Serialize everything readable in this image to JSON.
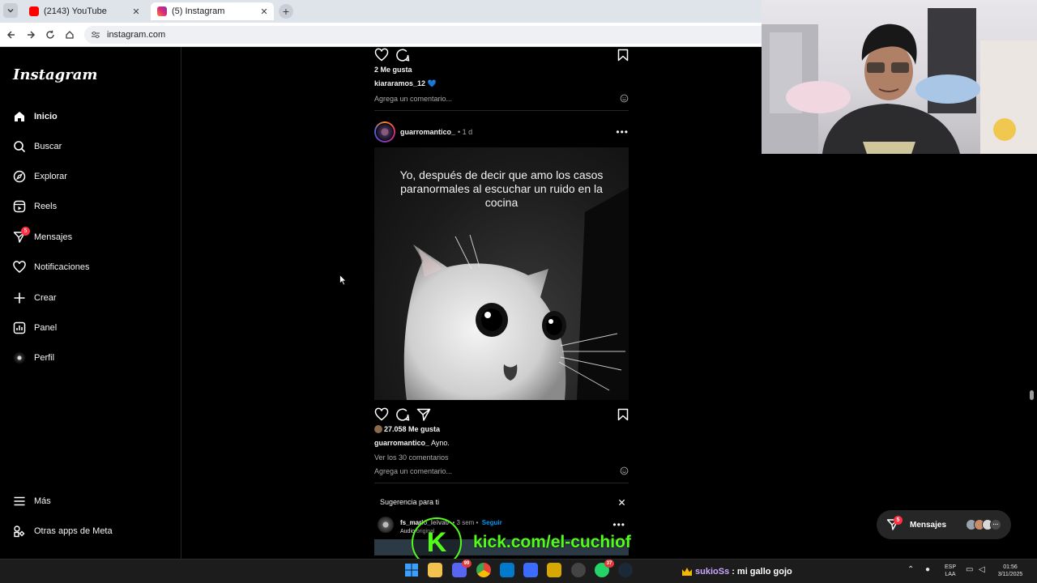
{
  "browser": {
    "tabs": [
      {
        "title": "(2143) YouTube",
        "color": "#ff0000"
      },
      {
        "title": "(5) Instagram",
        "color": "#d6249f"
      }
    ],
    "new_tab": "+",
    "url": "instagram.com"
  },
  "instagram": {
    "logo": "Instagram",
    "nav": [
      {
        "label": "Inicio",
        "icon": "home-icon"
      },
      {
        "label": "Buscar",
        "icon": "search-icon"
      },
      {
        "label": "Explorar",
        "icon": "compass-icon"
      },
      {
        "label": "Reels",
        "icon": "reels-icon"
      },
      {
        "label": "Mensajes",
        "icon": "messenger-icon",
        "badge": "5"
      },
      {
        "label": "Notificaciones",
        "icon": "heart-icon"
      },
      {
        "label": "Crear",
        "icon": "plus-icon"
      },
      {
        "label": "Panel",
        "icon": "dashboard-icon"
      },
      {
        "label": "Perfil",
        "icon": "avatar"
      }
    ],
    "bottom_nav": [
      {
        "label": "Más",
        "icon": "menu-icon"
      },
      {
        "label": "Otras apps de Meta",
        "icon": "meta-apps-icon"
      }
    ],
    "feed": {
      "prev_post": {
        "likes": "2 Me gusta",
        "caption_user": "kiararamos_12",
        "caption_text": "💙",
        "comment_placeholder": "Agrega un comentario..."
      },
      "post": {
        "user": "guarromantico_",
        "time": "• 1 d",
        "meme_text": "Yo, después de decir que amo los casos paranormales al escuchar un ruido en la cocina",
        "likes": "27.058 Me gusta",
        "caption_user": "guarromantico_",
        "caption_text": "Ayno.",
        "view_comments": "Ver los 30 comentarios",
        "comment_placeholder": "Agrega un comentario..."
      },
      "suggestion": {
        "heading": "Sugerencia para ti",
        "user": "fs_mario_leiva0",
        "time": "• 3 sem •",
        "follow": "Seguir",
        "audio": "Audio original"
      }
    },
    "messages_pill": {
      "label": "Mensajes",
      "badge": "5"
    }
  },
  "overlay": {
    "kick_logo": "K",
    "kick_url": "kick.com/el-cuchiof",
    "chat_user": "sukioSs",
    "chat_message": ": mi gallo gojo"
  },
  "taskbar": {
    "apps": [
      {
        "name": "windows-start",
        "color": "#3aa0ff"
      },
      {
        "name": "file-explorer",
        "color": "#f2c14e"
      },
      {
        "name": "discord",
        "color": "#5865f2",
        "badge": "99"
      },
      {
        "name": "chrome",
        "color": "#34a853"
      },
      {
        "name": "vscode",
        "color": "#007acc"
      },
      {
        "name": "app-blue",
        "color": "#3b6cff"
      },
      {
        "name": "app-yellow",
        "color": "#d6a800"
      },
      {
        "name": "obs",
        "color": "#444444"
      },
      {
        "name": "whatsapp",
        "color": "#25d366",
        "badge": "37"
      },
      {
        "name": "steam",
        "color": "#1b2838"
      }
    ],
    "lang": "ESP",
    "layout": "LAA",
    "time": "01:56",
    "date": "3/11/2025"
  }
}
